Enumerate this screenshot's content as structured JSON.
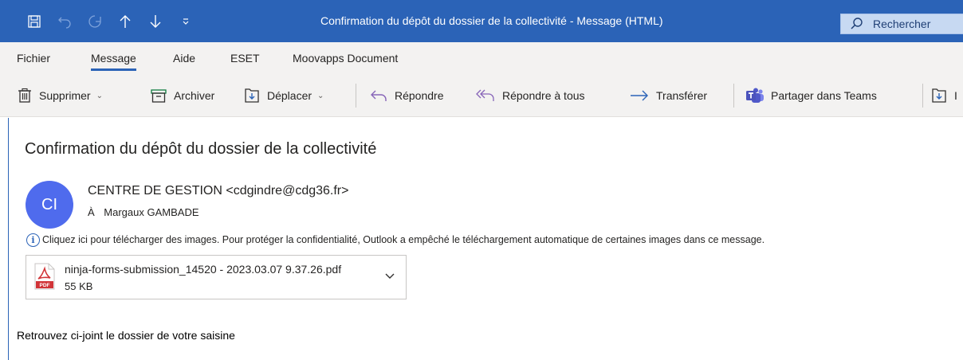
{
  "window": {
    "title": "Confirmation du dépôt du dossier de la collectivité  -  Message (HTML)",
    "search_label": "Rechercher",
    "title_bar_color": "#2b63b7"
  },
  "quick_access": [
    "save-icon",
    "undo-icon",
    "redo-icon",
    "up-arrow-icon",
    "down-arrow-icon",
    "customize-icon"
  ],
  "tabs": [
    {
      "label": "Fichier",
      "active": false
    },
    {
      "label": "Message",
      "active": true
    },
    {
      "label": "Aide",
      "active": false
    },
    {
      "label": "ESET",
      "active": false
    },
    {
      "label": "Moovapps Document",
      "active": false
    }
  ],
  "ribbon": {
    "delete": "Supprimer",
    "archive": "Archiver",
    "move": "Déplacer",
    "reply": "Répondre",
    "reply_all": "Répondre à tous",
    "forward": "Transférer",
    "share_teams": "Partager dans Teams",
    "next_truncated": "I"
  },
  "message": {
    "subject": "Confirmation du dépôt du dossier de la collectivité",
    "avatar_initials": "CI",
    "avatar_color": "#4f6bed",
    "sender": "CENTRE DE GESTION <cdgindre@cdg36.fr>",
    "to_prefix": "À",
    "to_name": "Margaux GAMBADE",
    "info_text": "Cliquez ici pour télécharger des images. Pour protéger la confidentialité, Outlook a empêché le téléchargement automatique de certaines images dans ce message.",
    "attachment": {
      "name": "ninja-forms-submission_14520 - 2023.03.07 9.37.26.pdf",
      "size": "55 KB",
      "type_label": "PDF"
    },
    "body": "Retrouvez ci-joint le dossier de votre saisine"
  }
}
